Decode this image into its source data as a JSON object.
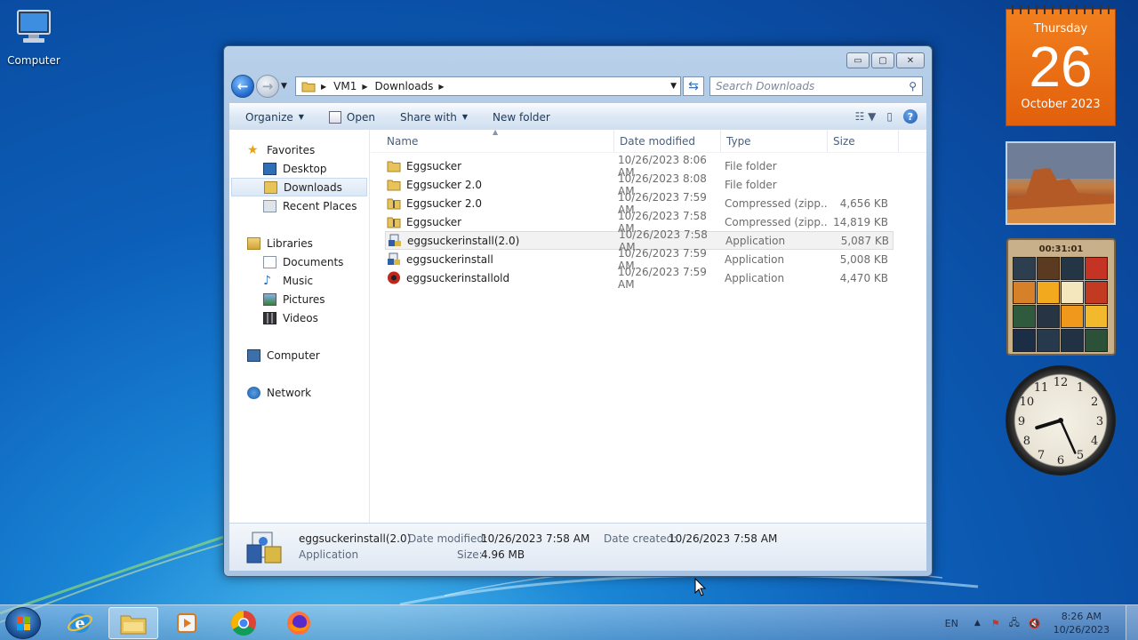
{
  "desktop": {
    "computer_label": "Computer"
  },
  "window": {
    "controls": {
      "minimize": "▭",
      "maximize": "▢",
      "close": "✕"
    },
    "nav": {
      "back": "←",
      "forward": "→"
    },
    "address": {
      "segments": [
        "VM1",
        "Downloads"
      ]
    },
    "search": {
      "placeholder": "Search Downloads"
    },
    "toolbar": {
      "organize": "Organize",
      "open": "Open",
      "share_with": "Share with",
      "new_folder": "New folder"
    },
    "navpane": {
      "favorites": "Favorites",
      "favorites_items": [
        "Desktop",
        "Downloads",
        "Recent Places"
      ],
      "libraries": "Libraries",
      "libraries_items": [
        "Documents",
        "Music",
        "Pictures",
        "Videos"
      ],
      "computer": "Computer",
      "network": "Network"
    },
    "columns": {
      "name": "Name",
      "date": "Date modified",
      "type": "Type",
      "size": "Size"
    },
    "files": [
      {
        "name": "Eggsucker",
        "date": "10/26/2023 8:06 AM",
        "type": "File folder",
        "size": "",
        "icon": "folder"
      },
      {
        "name": "Eggsucker 2.0",
        "date": "10/26/2023 8:08 AM",
        "type": "File folder",
        "size": "",
        "icon": "folder"
      },
      {
        "name": "Eggsucker 2.0",
        "date": "10/26/2023 7:59 AM",
        "type": "Compressed (zipp...",
        "size": "4,656 KB",
        "icon": "zip"
      },
      {
        "name": "Eggsucker",
        "date": "10/26/2023 7:58 AM",
        "type": "Compressed (zipp...",
        "size": "14,819 KB",
        "icon": "zip"
      },
      {
        "name": "eggsuckerinstall(2.0)",
        "date": "10/26/2023 7:58 AM",
        "type": "Application",
        "size": "5,087 KB",
        "icon": "installer"
      },
      {
        "name": "eggsuckerinstall",
        "date": "10/26/2023 7:59 AM",
        "type": "Application",
        "size": "5,008 KB",
        "icon": "installer"
      },
      {
        "name": "eggsuckerinstallold",
        "date": "10/26/2023 7:59 AM",
        "type": "Application",
        "size": "4,470 KB",
        "icon": "app-red"
      }
    ],
    "details": {
      "name": "eggsuckerinstall(2.0)",
      "type": "Application",
      "date_modified_label": "Date modified:",
      "date_modified": "10/26/2023 7:58 AM",
      "date_created_label": "Date created:",
      "date_created": "10/26/2023 7:58 AM",
      "size_label": "Size:",
      "size": "4.96 MB"
    }
  },
  "gadgets": {
    "calendar": {
      "weekday": "Thursday",
      "day": "26",
      "month_year": "October 2023"
    },
    "puzzle": {
      "timer": "00:31:01"
    },
    "clock": {
      "hour": 8,
      "minute": 26
    }
  },
  "taskbar": {
    "language": "EN",
    "time": "8:26 AM",
    "date": "10/26/2023"
  },
  "colors": {
    "accent": "#1f67c9",
    "calendar": "#e8680f"
  }
}
